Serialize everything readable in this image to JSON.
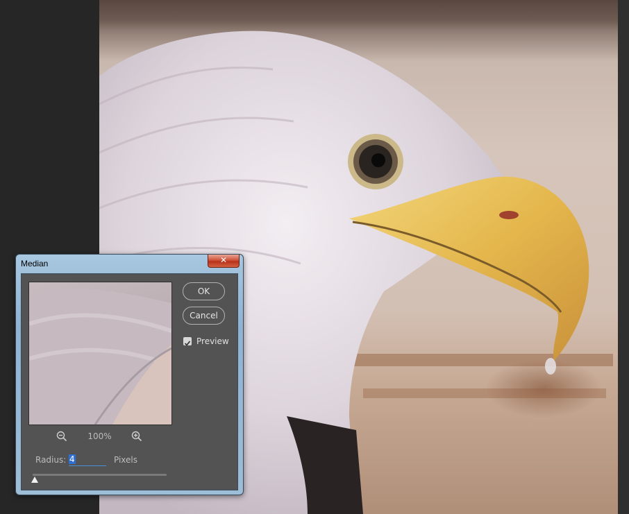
{
  "dialog": {
    "title": "Median",
    "close_label": "✕",
    "buttons": {
      "ok": "OK",
      "cancel": "Cancel"
    },
    "preview_checkbox": {
      "label": "Preview",
      "checked": true
    },
    "zoom": {
      "percent": "100%"
    },
    "radius": {
      "label": "Radius:",
      "value": "4",
      "unit": "Pixels"
    },
    "slider_value": 4
  },
  "icons": [
    "zoom-out-icon",
    "zoom-in-icon",
    "checkmark-icon",
    "close-icon"
  ],
  "colors": {
    "close_button": "#c9442a",
    "field_highlight": "#2f6fd1",
    "dialog_bg": "#535353"
  }
}
